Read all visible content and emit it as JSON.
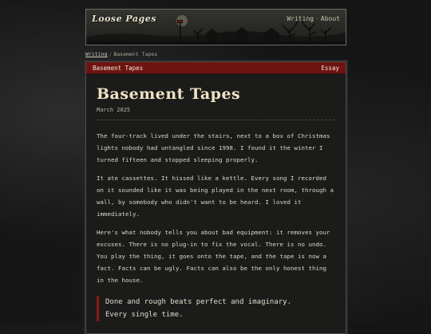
{
  "site": {
    "title": "Loose Pages",
    "nav": [
      {
        "label": "Writing"
      },
      {
        "label": "About"
      }
    ]
  },
  "breadcrumb": {
    "parent": "Writing",
    "current": "Basement Tapes"
  },
  "card": {
    "bar_title": "Basement Tapes",
    "category": "Essay"
  },
  "article": {
    "title": "Basement Tapes",
    "date": "March 2025",
    "paragraphs": [
      "The four-track lived under the stairs, next to a box of Christmas lights nobody had untangled since 1998. I found it the winter I turned fifteen and stopped sleeping properly.",
      "It ate cassettes. It hissed like a kettle. Every song I recorded on it sounded like it was being played in the next room, through a wall, by somebody who didn't want to be heard. I loved it immediately.",
      "Here's what nobody tells you about bad equipment: it removes your excuses. There is no plug-in to fix the vocal. There is no undo. You play the thing, it goes onto the tape, and the tape is now a fact. Facts can be ugly. Facts can also be the only honest thing in the house."
    ],
    "quote_lines": [
      "Done and rough beats perfect and imaginary.",
      "Every single time."
    ]
  }
}
